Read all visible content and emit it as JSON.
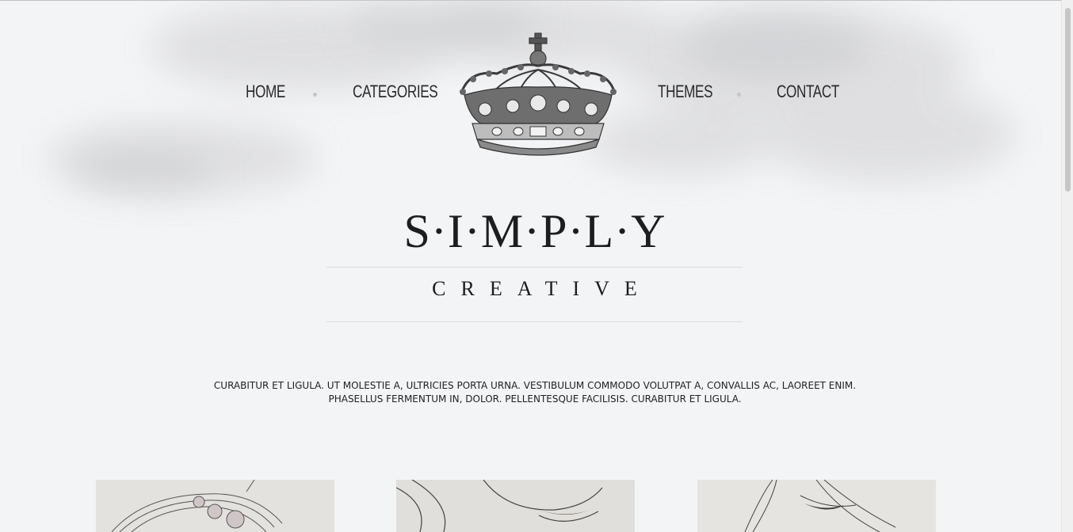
{
  "nav": {
    "left": [
      {
        "label": "HOME"
      },
      {
        "label": "CATEGORIES"
      }
    ],
    "right": [
      {
        "label": "THEMES"
      },
      {
        "label": "CONTACT"
      }
    ]
  },
  "logo": {
    "title": "S·I·M·P·L·Y",
    "subtitle": "CREATIVE"
  },
  "intro": {
    "line1": "CURABITUR ET LIGULA. UT MOLESTIE A, ULTRICIES PORTA URNA. VESTIBULUM COMMODO VOLUTPAT A, CONVALLIS AC, LAOREET ENIM.",
    "line2": "PHASELLUS FERMENTUM IN, DOLOR. PELLENTESQUE FACILISIS. CURABITUR ET LIGULA."
  },
  "icons": {
    "crown": "crown-emblem",
    "separator": "dot"
  },
  "colors": {
    "background": "#f3f4f6",
    "text": "#1d1d1d",
    "rule": "#dadbdd"
  }
}
